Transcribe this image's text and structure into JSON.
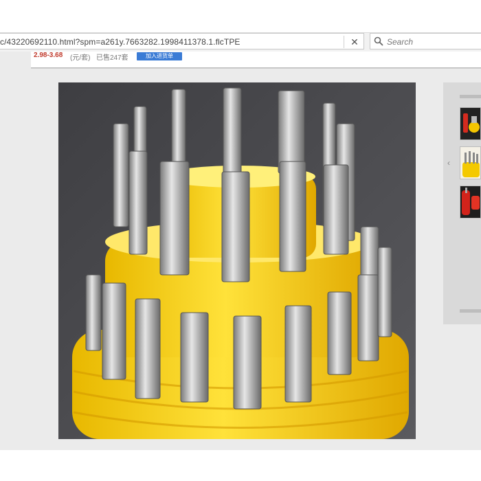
{
  "browser": {
    "url": "c/43220692110.html?spm=a261y.7663282.1998411378.1.flcTPE",
    "close_glyph": "✕",
    "search_placeholder": "Search"
  },
  "listing": {
    "price_range": "2.98-3.68",
    "unit": "(元/套)",
    "sold": "已售247套",
    "cart_button": "加入进货单"
  },
  "gallery": {
    "main_image_icon": "screwdriver-bit-set-photo",
    "thumb_prev_glyph": "‹",
    "thumbnails": [
      {
        "icon": "thumb-red-screwdriver"
      },
      {
        "icon": "thumb-yellow-bit-set"
      },
      {
        "icon": "thumb-red-handle"
      }
    ]
  },
  "colors": {
    "toolbar_bg": "#f2f2f2",
    "page_bg": "#ebebeb",
    "price": "#c0392b",
    "button": "#3a7bd5",
    "plastic_yellow": "#f7d81c",
    "metal": "#b9b9b9"
  }
}
